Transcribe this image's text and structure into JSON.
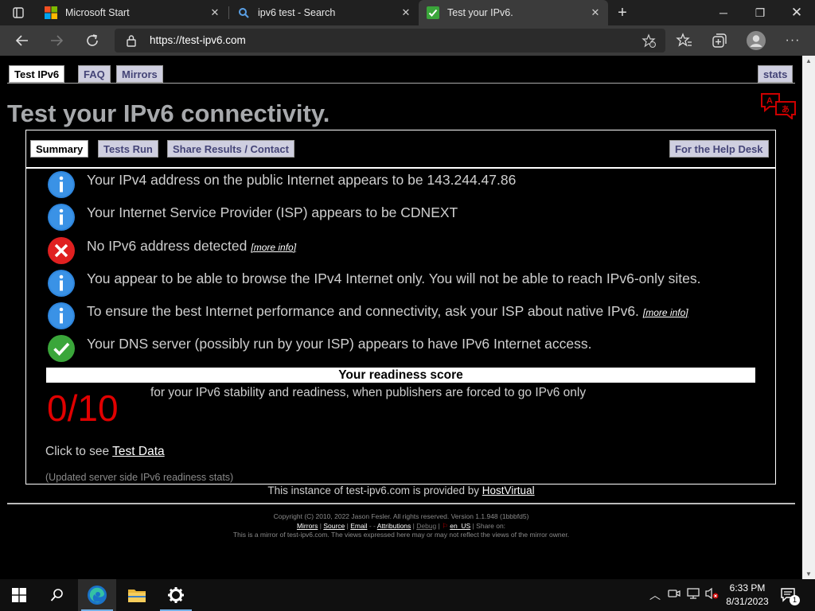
{
  "browser": {
    "tabs": [
      {
        "title": "Microsoft Start"
      },
      {
        "title": "ipv6 test - Search"
      },
      {
        "title": "Test your IPv6."
      }
    ],
    "url": "https://test-ipv6.com"
  },
  "page": {
    "top_tabs": [
      "Test IPv6",
      "FAQ",
      "Mirrors"
    ],
    "stats_tab": "stats",
    "heading": "Test your IPv6 connectivity.",
    "inner_tabs": [
      "Summary",
      "Tests Run",
      "Share Results / Contact"
    ],
    "help_tab": "For the Help Desk",
    "results": [
      {
        "status": "info",
        "text": "Your IPv4 address on the public Internet appears to be 143.244.47.86",
        "more": ""
      },
      {
        "status": "info",
        "text": "Your Internet Service Provider (ISP) appears to be CDNEXT",
        "more": ""
      },
      {
        "status": "error",
        "text": "No IPv6 address detected",
        "more": "[more info]"
      },
      {
        "status": "info",
        "text": "You appear to be able to browse the IPv4 Internet only. You will not be able to reach IPv6-only sites.",
        "more": ""
      },
      {
        "status": "info",
        "text": "To ensure the best Internet performance and connectivity, ask your ISP about native IPv6.",
        "more": "[more info]"
      },
      {
        "status": "ok",
        "text": "Your DNS server (possibly run by your ISP) appears to have IPv6 Internet access.",
        "more": ""
      }
    ],
    "score_title": "Your readiness score",
    "score": "0/10",
    "score_desc": "for your IPv6 stability and readiness, when publishers are forced to go IPv6 only",
    "click_prefix": "Click to see",
    "test_data_link": "Test Data",
    "updated": "(Updated server side IPv6 readiness stats)",
    "instance_prefix": "This instance of test-ipv6.com is provided by",
    "instance_link": "HostVirtual",
    "footer": {
      "copyright": "Copyright (C) 2010, 2022 Jason Fesler. All rights reserved. Version 1.1.948 (1bbbfd5)",
      "links": [
        "Mirrors",
        "Source",
        "Email",
        "Attributions",
        "Debug",
        "en_US"
      ],
      "share": "| Share on:",
      "mirror_note": "This is a mirror of test-ipv6.com. The views expressed here may or may not reflect the views of the mirror owner."
    }
  },
  "taskbar": {
    "time": "6:33 PM",
    "date": "8/31/2023",
    "notification_count": "1"
  },
  "colors": {
    "info": "#2e86de",
    "error": "#e02020",
    "ok": "#3aa63a",
    "score": "#e00000",
    "heading": "#a7a9ac"
  }
}
